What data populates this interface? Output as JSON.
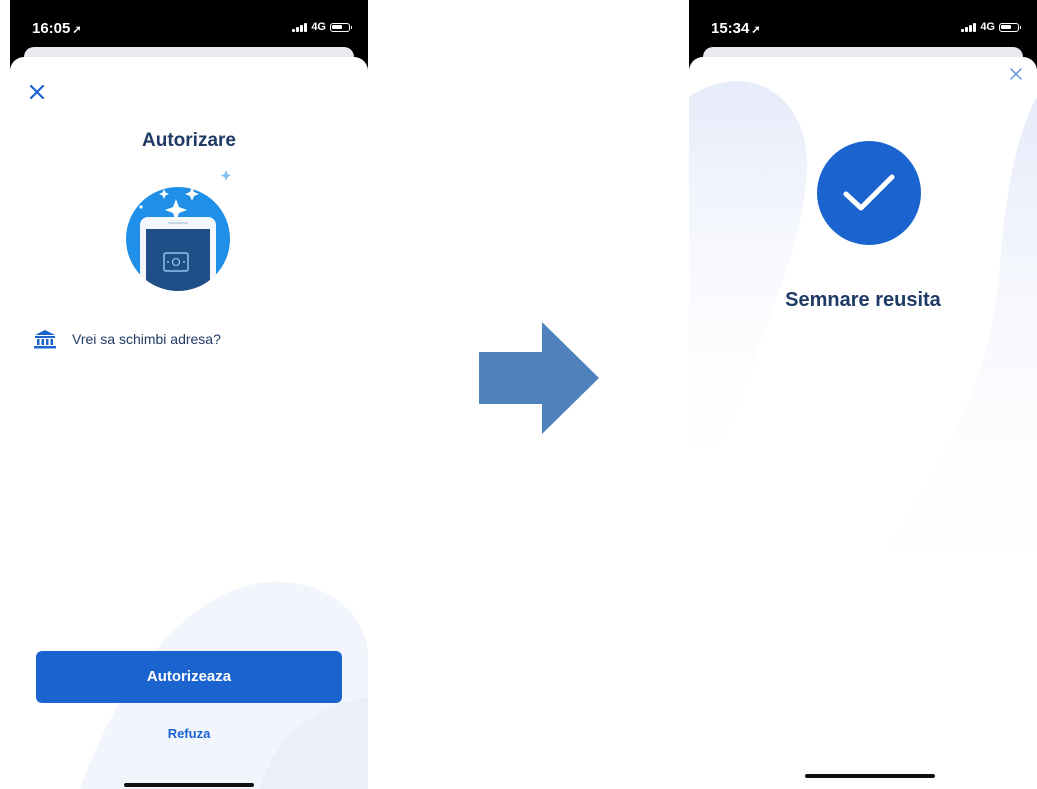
{
  "left_screen": {
    "status": {
      "time": "16:05",
      "network": "4G"
    },
    "close_icon": "close-icon",
    "title": "Autorizare",
    "illustration": "phone-card-sparkles-illustration",
    "info": {
      "icon": "bank-icon",
      "text": "Vrei sa schimbi adresa?"
    },
    "primary_button": "Autorizeaza",
    "secondary_button": "Refuza"
  },
  "transition_arrow": "right-arrow-icon",
  "right_screen": {
    "status": {
      "time": "15:34",
      "network": "4G"
    },
    "close_icon": "close-icon",
    "success_icon": "checkmark-icon",
    "title": "Semnare reusita"
  },
  "colors": {
    "brand_blue": "#1b64d0",
    "title_navy": "#1f3b65",
    "arrow": "#4f81bd"
  }
}
